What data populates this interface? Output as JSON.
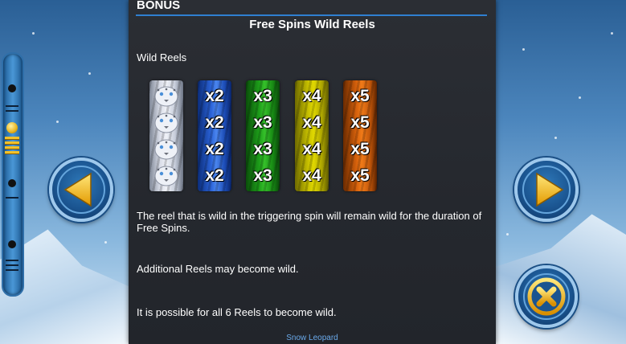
{
  "panel": {
    "section_title": "BONUS",
    "heading": "Free Spins Wild Reels",
    "wild_reels_label": "Wild Reels",
    "paragraphs": [
      "The reel that is wild in the triggering spin will remain wild for the duration of Free Spins.",
      "Additional Reels may become wild.",
      "It is possible for all 6 Reels to become wild."
    ],
    "footer": "Snow Leopard"
  },
  "reels": [
    {
      "name": "leopard",
      "color": "#d7dbe6",
      "labels": [
        "",
        "",
        "",
        ""
      ]
    },
    {
      "name": "x2",
      "color": "#2b63d8",
      "labels": [
        "x2",
        "x2",
        "x2",
        "x2"
      ]
    },
    {
      "name": "x3",
      "color": "#1ea01a",
      "labels": [
        "x3",
        "x3",
        "x3",
        "x3"
      ]
    },
    {
      "name": "x4",
      "color": "#c9c200",
      "labels": [
        "x4",
        "x4",
        "x4",
        "x4"
      ]
    },
    {
      "name": "x5",
      "color": "#d8620c",
      "labels": [
        "x5",
        "x5",
        "x5",
        "x5"
      ]
    }
  ],
  "controls": {
    "left_icon": "arrow-left-icon",
    "right_icon": "arrow-right-icon",
    "close_icon": "close-icon",
    "accent": "#f2c12a"
  }
}
